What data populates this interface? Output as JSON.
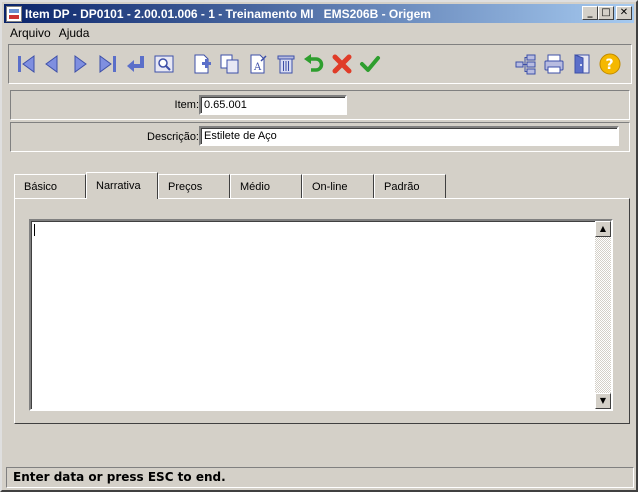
{
  "window": {
    "title": "Item DP - DP0101 - 2.00.01.006 - 1 - Treinamento MI   EMS206B - Origem"
  },
  "menu": [
    "Arquivo",
    "Ajuda"
  ],
  "toolbar": {
    "icons": [
      "first-icon",
      "prev-icon",
      "next-icon",
      "last-icon",
      "goto-icon",
      "search-icon",
      "new-icon",
      "copy-icon",
      "edit-icon",
      "delete-icon",
      "undo-icon",
      "cancel-icon",
      "save-icon",
      "tree-icon",
      "print-icon",
      "exit-icon",
      "help-icon"
    ],
    "colors": {
      "blue": "#5b6fc9",
      "green": "#2e9e2e",
      "red": "#e03c28",
      "yellow": "#f5b800"
    }
  },
  "fields": {
    "item": {
      "label": "Item:",
      "value": "0.65.001"
    },
    "descricao": {
      "label": "Descrição:",
      "value": "Estilete de Aço"
    }
  },
  "tabs": [
    {
      "label": "Básico",
      "active": false
    },
    {
      "label": "Narrativa",
      "active": true
    },
    {
      "label": "Preços",
      "active": false
    },
    {
      "label": "Médio",
      "active": false
    },
    {
      "label": "On-line",
      "active": false
    },
    {
      "label": "Padrão",
      "active": false
    }
  ],
  "narrative": {
    "value": ""
  },
  "status": {
    "text": "Enter data or press ESC to end."
  }
}
